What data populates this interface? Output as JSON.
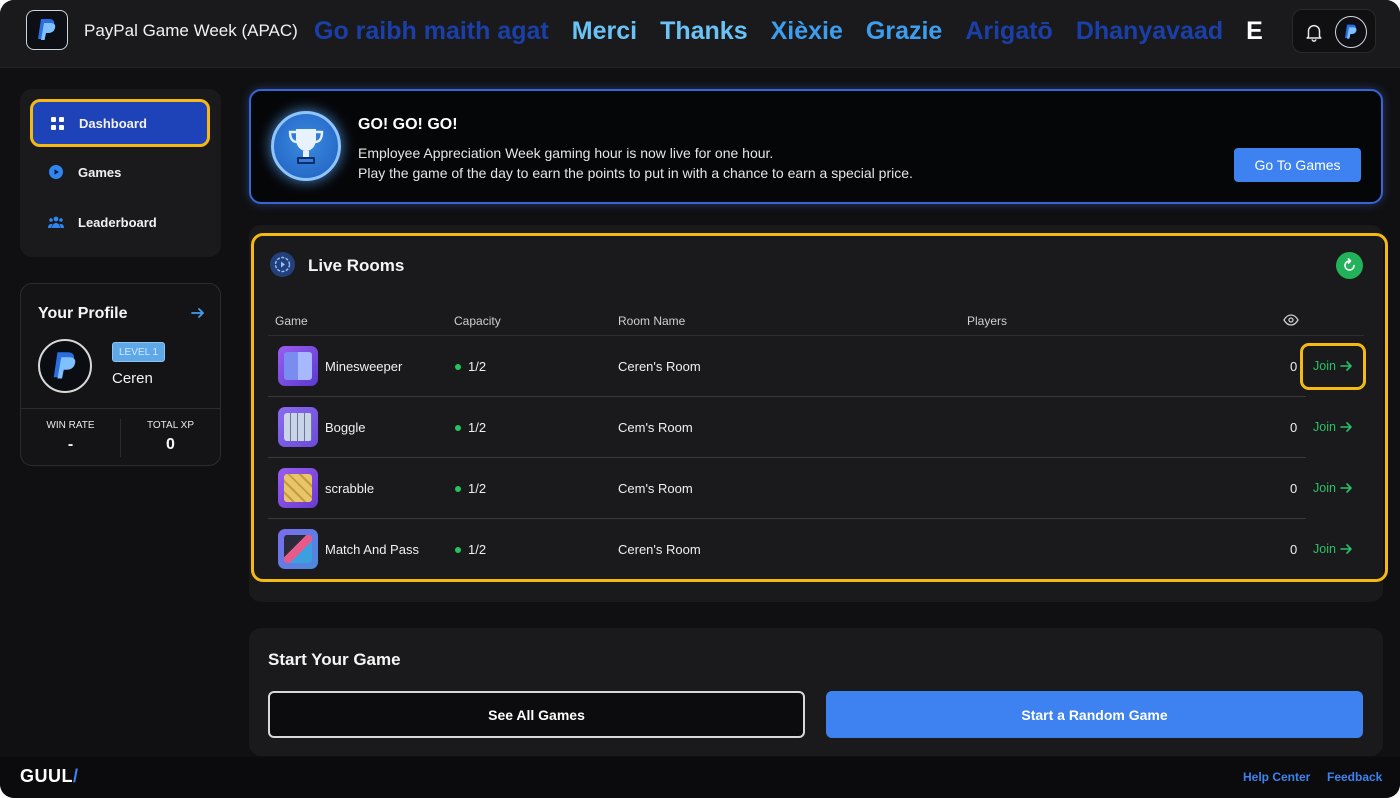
{
  "header": {
    "app_title": "PayPal Game Week (APAC)",
    "marquee": [
      {
        "text": "Go raibh maith agat",
        "color": "#1b3fa8"
      },
      {
        "text": "Merci",
        "color": "#6ac2f6"
      },
      {
        "text": "Thanks",
        "color": "#6ac2f6"
      },
      {
        "text": "Xièxie",
        "color": "#3d9ef0"
      },
      {
        "text": "Grazie",
        "color": "#3d9ef0"
      },
      {
        "text": "Arigatō",
        "color": "#1b3fa8"
      },
      {
        "text": "Dhanyavaad",
        "color": "#1b3fa8"
      },
      {
        "text": "E",
        "color": "#ffffff"
      }
    ],
    "icons": {
      "notifications": "bell-icon",
      "account": "paypal-avatar"
    }
  },
  "sidebar": {
    "items": [
      {
        "label": "Dashboard",
        "icon": "grid-icon",
        "active": true
      },
      {
        "label": "Games",
        "icon": "play-circle-icon",
        "active": false
      },
      {
        "label": "Leaderboard",
        "icon": "users-icon",
        "active": false
      }
    ]
  },
  "profile": {
    "title": "Your Profile",
    "level": "LEVEL 1",
    "name": "Ceren",
    "win_rate_label": "WIN RATE",
    "win_rate": "-",
    "total_xp_label": "TOTAL XP",
    "total_xp": "0"
  },
  "banner": {
    "title": "GO! GO! GO!",
    "line1": "Employee Appreciation Week gaming hour is now live for one hour.",
    "line2": "Play the game of the day to earn the points to put in with a chance to earn a special price.",
    "button": "Go To Games"
  },
  "live_rooms": {
    "title": "Live Rooms",
    "columns": [
      "Game",
      "Capacity",
      "Room Name",
      "Players"
    ],
    "rows": [
      {
        "game": "Minesweeper",
        "capacity": "1/2",
        "room": "Ceren's Room",
        "players": "0",
        "join": "Join"
      },
      {
        "game": "Boggle",
        "capacity": "1/2",
        "room": "Cem's Room",
        "players": "0",
        "join": "Join"
      },
      {
        "game": "scrabble",
        "capacity": "1/2",
        "room": "Cem's Room",
        "players": "0",
        "join": "Join"
      },
      {
        "game": "Match And Pass",
        "capacity": "1/2",
        "room": "Ceren's Room",
        "players": "0",
        "join": "Join"
      }
    ]
  },
  "start_game": {
    "title": "Start Your Game",
    "see_all": "See All Games",
    "random": "Start a Random Game"
  },
  "footer": {
    "logo": "GUUL",
    "logo_mark": "/",
    "help": "Help Center",
    "feedback": "Feedback"
  },
  "colors": {
    "accent": "#3d82f0",
    "highlight": "#f5b914",
    "success": "#22c55e"
  }
}
